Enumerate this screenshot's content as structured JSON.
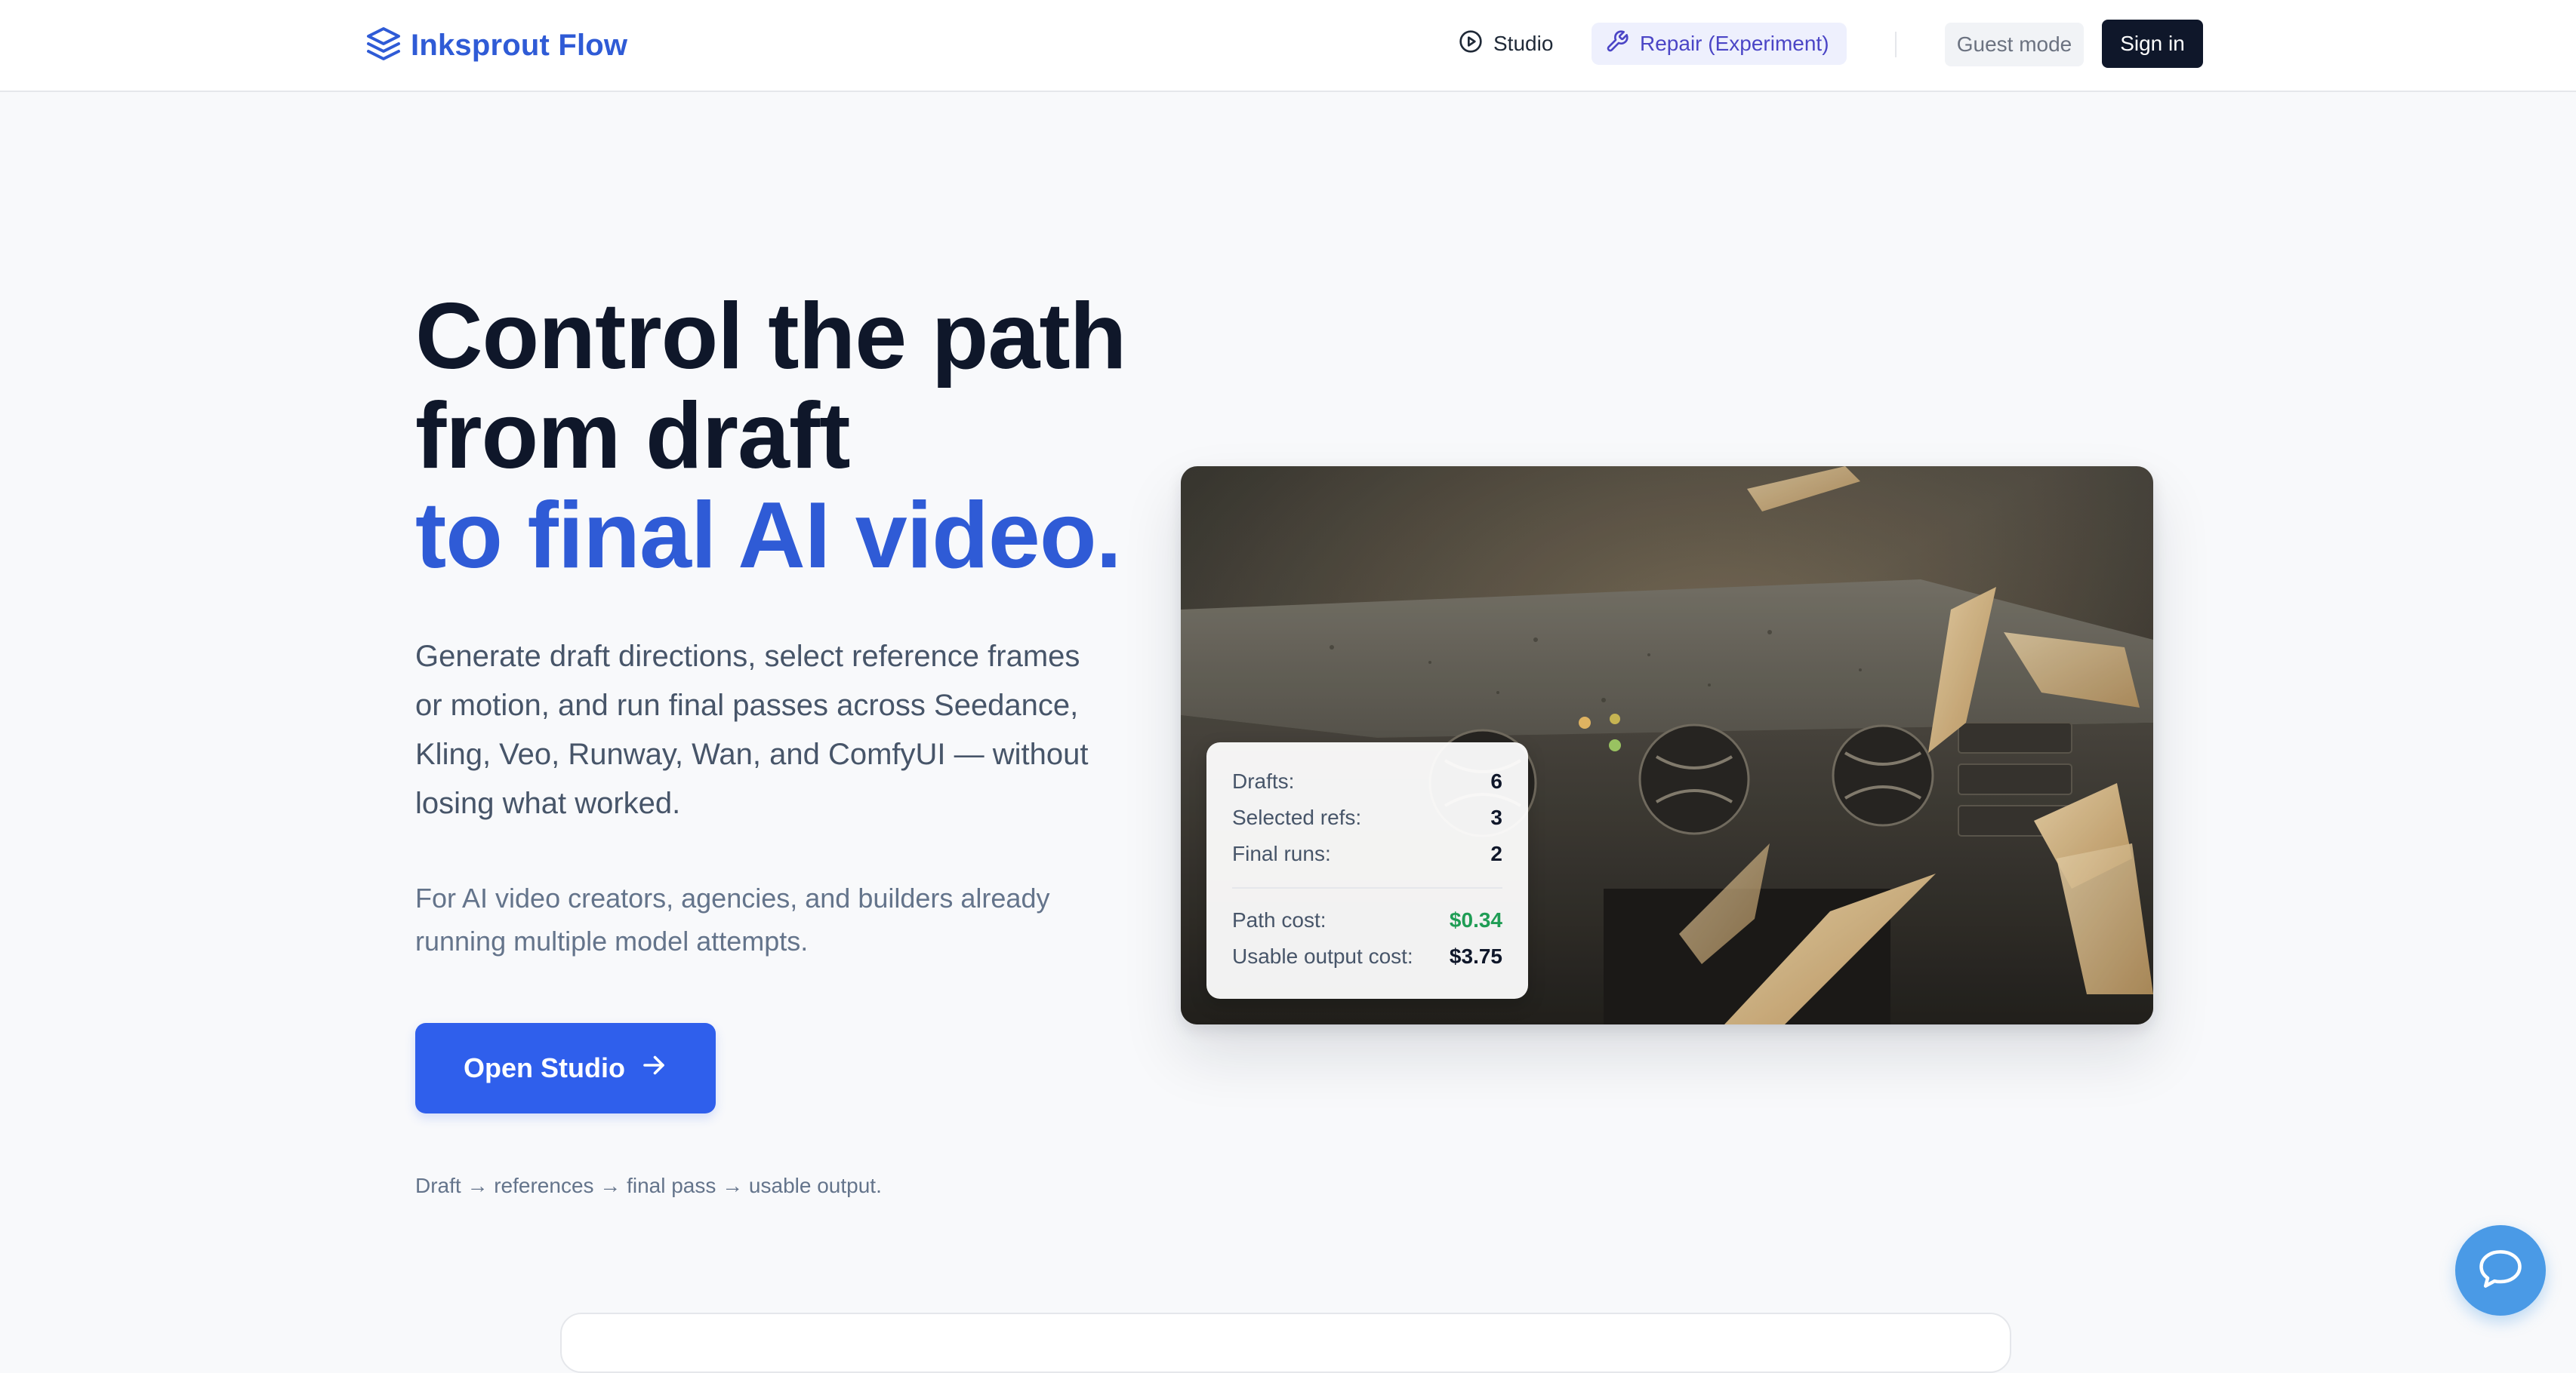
{
  "nav": {
    "brand": "Inksprout Flow",
    "studio_label": "Studio",
    "repair_label": "Repair (Experiment)",
    "guest_label": "Guest mode",
    "signin_label": "Sign in"
  },
  "hero": {
    "title_line1": "Control the path",
    "title_line2": "from draft",
    "title_accent": "to final AI video.",
    "description": "Generate draft directions, select reference frames or motion, and run final passes across Seedance, Kling, Veo, Runway, Wan, and ComfyUI — without losing what worked.",
    "subtext": "For AI video creators, agencies, and builders already running multiple model attempts.",
    "cta_label": "Open Studio",
    "flow_note": "Draft → references → final pass → usable output."
  },
  "stats": {
    "drafts_label": "Drafts:",
    "drafts_value": "6",
    "refs_label": "Selected refs:",
    "refs_value": "3",
    "runs_label": "Final runs:",
    "runs_value": "2",
    "path_cost_label": "Path cost:",
    "path_cost_value": "$0.34",
    "usable_cost_label": "Usable output cost:",
    "usable_cost_value": "$3.75"
  },
  "icons": {
    "brand": "layers-icon",
    "studio": "play-circle-icon",
    "repair": "wrench-icon",
    "cta": "arrow-right-icon",
    "chat": "chat-bubble-icon"
  },
  "colors": {
    "accent": "#2f5bd6",
    "cta": "#2f5fec",
    "positive": "#1f9d55",
    "dark": "#0f172a",
    "chat": "#4a9ae6"
  }
}
